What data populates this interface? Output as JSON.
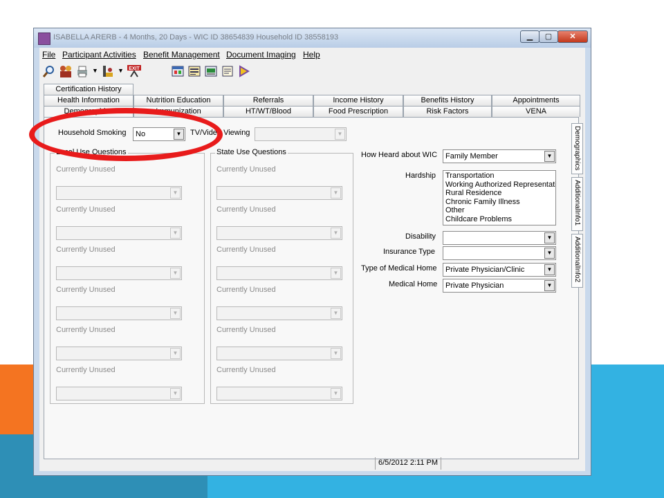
{
  "window": {
    "title": "ISABELLA ARERB - 4 Months, 20 Days - WIC ID 38654839 Household ID 38558193"
  },
  "menu": {
    "items": [
      "File",
      "Participant Activities",
      "Benefit Management",
      "Document Imaging",
      "Help"
    ]
  },
  "toolbar": {
    "icons": [
      "search-icon",
      "family-icon",
      "print-icon",
      "scale-icon",
      "exit-icon",
      "window-icon",
      "form-icon",
      "scanner-icon",
      "notepad-icon",
      "arrow-icon"
    ],
    "exit_label": "EXIT"
  },
  "tabs": {
    "row1": [
      "Certification History"
    ],
    "row2": [
      "Health Information",
      "Nutrition Education",
      "Referrals",
      "Income History",
      "Benefits History",
      "Appointments"
    ],
    "row3": [
      "Demographics",
      "Immunization",
      "HT/WT/Blood",
      "Food Prescription",
      "Risk Factors",
      "VENA"
    ],
    "vertical": [
      "Demographics",
      "AdditionalInfo1",
      "AdditionalInfo2"
    ]
  },
  "form": {
    "household_smoking_label": "Household Smoking",
    "household_smoking_value": "No",
    "tv_video_label": "TV/Video Viewing",
    "tv_video_value": "",
    "local_group_title": "Local Use Questions",
    "state_group_title": "State Use Questions",
    "unused_label": "Currently Unused",
    "how_heard_label": "How Heard about WIC",
    "how_heard_value": "Family Member",
    "hardship_label": "Hardship",
    "hardship_options": [
      "Transportation",
      "Working Authorized Representativ",
      "Rural Residence",
      "Chronic Family Illness",
      "Other",
      "Childcare Problems"
    ],
    "disability_label": "Disability",
    "disability_value": "",
    "insurance_label": "Insurance Type",
    "insurance_value": "",
    "medical_home_type_label": "Type of Medical Home",
    "medical_home_type_value": "Private Physician/Clinic",
    "medical_home_label": "Medical Home",
    "medical_home_value": "Private Physician"
  },
  "status": {
    "datetime": "6/5/2012  2:11 PM"
  },
  "colors": {
    "highlight_ring": "#e81b1b",
    "deco_orange": "#f47421",
    "deco_blue": "#33b2e2"
  }
}
